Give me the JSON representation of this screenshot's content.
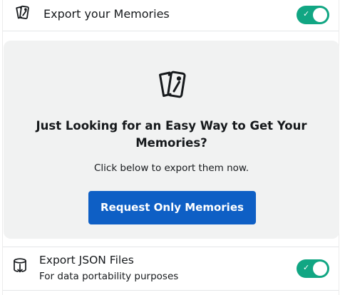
{
  "memories_row": {
    "label": "Export your Memories",
    "icon": "memories-photos-icon",
    "toggle_on": true
  },
  "promo_card": {
    "icon": "memories-photos-icon",
    "headline": "Just Looking for an Easy Way to Get Your Memories?",
    "subtext": "Click below to export them now.",
    "button_label": "Request Only Memories"
  },
  "json_row": {
    "label": "Export JSON Files",
    "sublabel": "For data portability purposes",
    "icon": "database-export-icon",
    "toggle_on": true
  },
  "colors": {
    "toggle_on": "#11a683",
    "button": "#0e5fc5",
    "card_background": "#f1f2f2"
  }
}
